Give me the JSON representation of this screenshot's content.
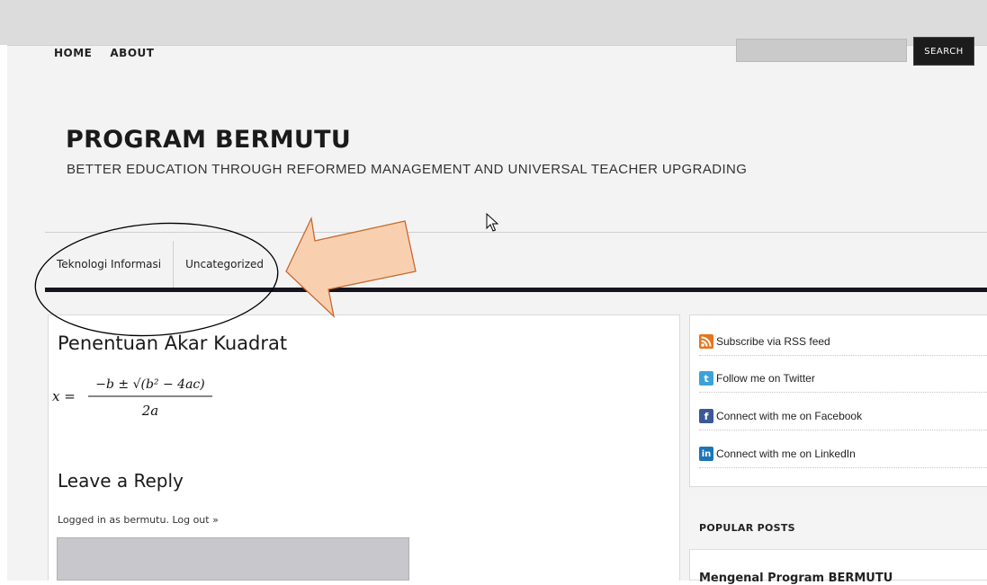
{
  "nav": {
    "items": [
      "HOME",
      "ABOUT"
    ]
  },
  "search": {
    "value": "",
    "button_label": "SEARCH"
  },
  "site": {
    "title": "PROGRAM BERMUTU",
    "description": "BETTER EDUCATION THROUGH REFORMED MANAGEMENT AND UNIVERSAL TEACHER UPGRADING"
  },
  "categories": [
    "Teknologi Informasi",
    "Uncategorized"
  ],
  "post": {
    "title": "Penentuan Akar Kuadrat",
    "formula": {
      "lhs": "x =",
      "numerator": "−b ± √(b² − 4ac)",
      "denominator": "2a"
    }
  },
  "reply": {
    "title": "Leave a Reply",
    "logged_prefix": "Logged in as ",
    "user": "bermutu",
    "separator": ". ",
    "logout": "Log out »"
  },
  "sidebar": {
    "social": [
      {
        "icon": "rss-icon",
        "label": "Subscribe via RSS feed",
        "color": "#e8741b"
      },
      {
        "icon": "twitter-icon",
        "label": "Follow me on Twitter",
        "color": "#3ba3d8"
      },
      {
        "icon": "facebook-icon",
        "label": "Connect with me on Facebook",
        "color": "#3b5998"
      },
      {
        "icon": "linkedin-icon",
        "label": "Connect with me on LinkedIn",
        "color": "#1c75b5"
      }
    ],
    "popular_title": "POPULAR POSTS",
    "popular_items": [
      "Mengenal Program BERMUTU"
    ]
  },
  "colors": {
    "arrow_fill": "#f8d0b0",
    "arrow_stroke": "#c8692e",
    "nav_bar": "#151520"
  }
}
